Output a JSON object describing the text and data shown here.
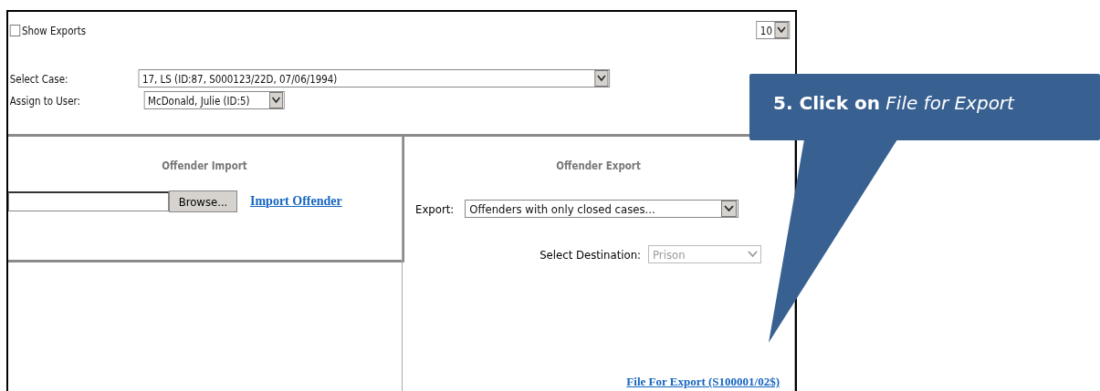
{
  "top": {
    "show_exports": {
      "label": "Show Exports",
      "checked": false
    },
    "page_size": "10"
  },
  "case": {
    "label": "Select Case:",
    "value": "17, LS (ID:87, S000123/22D, 07/06/1994)"
  },
  "user": {
    "label": "Assign to User:",
    "value": "McDonald, Julie (ID:5)"
  },
  "import_panel": {
    "title": "Offender Import",
    "browse": "Browse...",
    "link": "Import Offender"
  },
  "export_panel": {
    "title": "Offender Export",
    "export_label": "Export:",
    "export_value": "Offenders with only closed cases...",
    "destination_label": "Select Destination:",
    "destination_value": "Prison",
    "destination_disabled": true,
    "link": "File For Export (S100001/02$)"
  },
  "callout": {
    "text": "**5. Click on** *File for Export*"
  }
}
